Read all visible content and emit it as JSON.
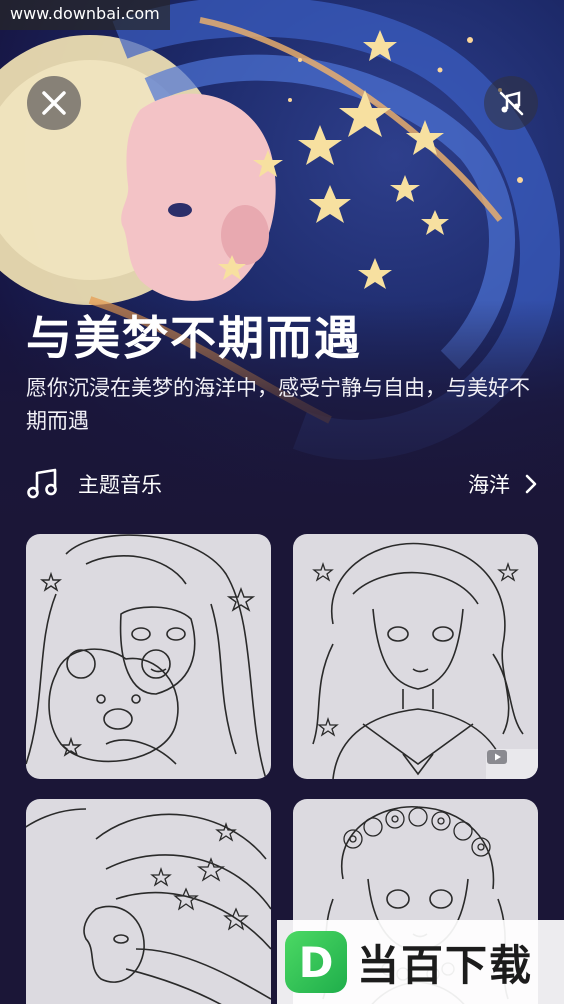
{
  "watermark": {
    "site": "www.downbai.com"
  },
  "header": {
    "close_icon": "close-icon",
    "music_icon": "music-off-icon"
  },
  "hero": {
    "title": "与美梦不期而遇",
    "subtitle": "愿你沉浸在美梦的海洋中，感受宁静与自由，与美好不期而遇"
  },
  "theme": {
    "icon": "music-note-icon",
    "label": "主题音乐",
    "value": "海洋",
    "chevron": "chevron-right-icon"
  },
  "cards": [
    {
      "subject": "girl-with-teddy-bear"
    },
    {
      "subject": "girl-sailor-collar",
      "badge_icon": "video-icon"
    },
    {
      "subject": "girl-with-moon-and-stars"
    },
    {
      "subject": "girl-with-flower-crown"
    }
  ],
  "brand_watermark": {
    "logo_letter": "D",
    "text": "当百下载"
  },
  "colors": {
    "background": "#1b1637",
    "card": "#dcdae0",
    "brand_green": "#1fae4b"
  }
}
